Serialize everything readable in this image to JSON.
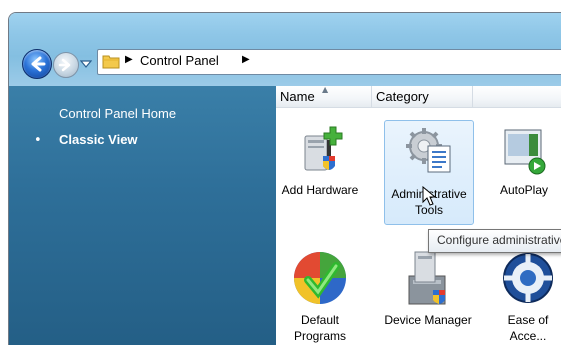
{
  "address": {
    "breadcrumb": "Control Panel"
  },
  "sidebar": {
    "items": [
      {
        "label": "Control Panel Home"
      },
      {
        "label": "Classic View",
        "bullet": "•"
      }
    ]
  },
  "columns": {
    "name": "Name",
    "category": "Category"
  },
  "items": [
    {
      "label": "Add Hardware",
      "icon": "add-hardware-icon"
    },
    {
      "label": "Administrative Tools",
      "icon": "administrative-tools-icon",
      "selected": true
    },
    {
      "label": "AutoPlay",
      "icon": "autoplay-icon"
    },
    {
      "label": "Default Programs",
      "icon": "default-programs-icon"
    },
    {
      "label": "Device Manager",
      "icon": "device-manager-icon"
    },
    {
      "label": "Ease of Acce...",
      "icon": "ease-of-access-icon"
    }
  ],
  "tooltip": {
    "text": "Configure administrative settings for your computer."
  },
  "colors": {
    "sidebar": "#2e6f99",
    "titlebar": "#8ec6e7",
    "selection": "#d6eafb"
  }
}
